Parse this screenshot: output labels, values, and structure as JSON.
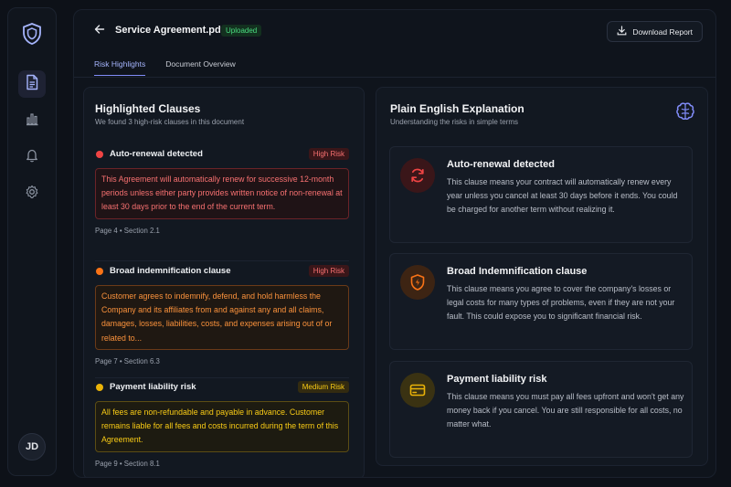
{
  "sidebar": {
    "avatar_initials": "JD",
    "items": [
      {
        "name": "documents",
        "icon": "document-icon",
        "active": true
      },
      {
        "name": "analytics",
        "icon": "bar-chart-icon",
        "active": false
      },
      {
        "name": "notifications",
        "icon": "bell-icon",
        "active": false
      },
      {
        "name": "settings",
        "icon": "gear-icon",
        "active": false
      }
    ],
    "logo_icon": "shield-icon"
  },
  "header": {
    "title": "Service Agreement.pdf",
    "status_badge": "Uploaded",
    "download_label": "Download Report"
  },
  "tabs": [
    {
      "label": "Risk Highlights",
      "active": true
    },
    {
      "label": "Document Overview",
      "active": false
    }
  ],
  "clauses_panel": {
    "title": "Highlighted Clauses",
    "subtitle": "We found 3 high-risk clauses in this document",
    "clauses": [
      {
        "name": "Auto-renewal detected",
        "risk": "High Risk",
        "color": "#ef4444",
        "quote": "This Agreement will automatically renew for successive 12-month periods unless either party provides written notice of non-renewal at least 30 days prior to the end of the current term.",
        "page": "Page 4",
        "section": "Section 2.1"
      },
      {
        "name": "Broad indemnification clause",
        "risk": "High Risk",
        "color": "#f97316",
        "quote": "Customer agrees to indemnify, defend, and hold harmless the Company and its affiliates from and against any and all claims, damages, losses, liabilities, costs, and expenses arising out of or related to...",
        "page": "Page 7",
        "section": "Section 6.3"
      },
      {
        "name": "Payment liability risk",
        "risk": "Medium Risk",
        "color": "#eab308",
        "quote": "All fees are non-refundable and payable in advance. Customer remains liable for all fees and costs incurred during the term of this Agreement.",
        "page": "Page 9",
        "section": "Section 8.1"
      }
    ]
  },
  "explanation_panel": {
    "title": "Plain English Explanation",
    "subtitle": "Understanding the risks in simple terms",
    "cards": [
      {
        "title": "Auto-renewal detected",
        "icon": "refresh-icon",
        "text": "This clause means your contract will automatically renew every year unless you cancel at least 30 days before it ends. You could be charged for another term without realizing it."
      },
      {
        "title": "Broad Indemnification clause",
        "icon": "shield-bolt-icon",
        "text": "This clause means you agree to cover the company's losses or legal costs for many types of problems, even if they are not your fault. This could expose you to significant financial risk."
      },
      {
        "title": "Payment liability risk",
        "icon": "credit-card-icon",
        "text": "This clause means you must pay all fees upfront and won't get any money back if you cancel. You are still responsible for all costs, no matter what."
      }
    ]
  }
}
